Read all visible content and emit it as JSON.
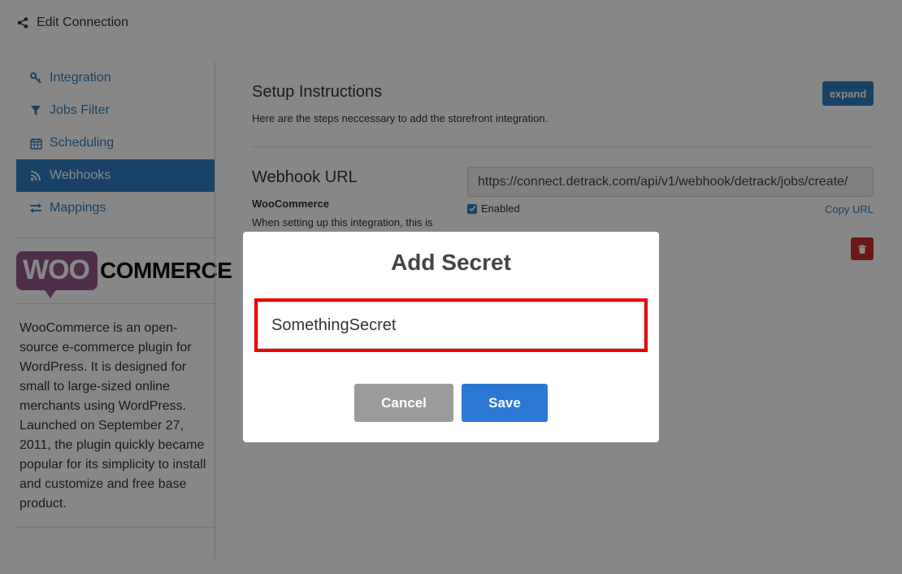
{
  "header": {
    "title": "Edit Connection",
    "icon": "share-icon"
  },
  "sidebar": {
    "items": [
      {
        "label": "Integration",
        "icon": "key-icon",
        "active": false
      },
      {
        "label": "Jobs Filter",
        "icon": "filter-icon",
        "active": false
      },
      {
        "label": "Scheduling",
        "icon": "calendar-icon",
        "active": false
      },
      {
        "label": "Webhooks",
        "icon": "rss-icon",
        "active": true
      },
      {
        "label": "Mappings",
        "icon": "arrows-exchange-icon",
        "active": false
      }
    ],
    "logo": {
      "woo": "WOO",
      "commerce": "COMMERCE"
    },
    "description": "WooCommerce is an open-source e-commerce plugin for WordPress. It is designed for small to large-sized online merchants using WordPress. Launched on September 27, 2011, the plugin quickly became popular for its simplicity to install and customize and free base product."
  },
  "main": {
    "setup": {
      "title": "Setup Instructions",
      "subtitle": "Here are the steps neccessary to add the storefront integration.",
      "expand_label": "expand"
    },
    "webhook": {
      "title": "Webhook URL",
      "platform": "WooCommerce",
      "note": "When setting up this integration, this is",
      "url": "https://connect.detrack.com/api/v1/webhook/detrack/jobs/create/",
      "enabled_label": "Enabled",
      "enabled": true,
      "copy_label": "Copy URL"
    }
  },
  "modal": {
    "title": "Add Secret",
    "secret_value": "SomethingSecret",
    "cancel_label": "Cancel",
    "save_label": "Save"
  },
  "colors": {
    "primary": "#2f7fc1",
    "save": "#2b78d4",
    "cancel": "#9b9b9b",
    "danger": "#c9302c",
    "highlight": "#ee0000",
    "woo_purple": "#96588a"
  }
}
